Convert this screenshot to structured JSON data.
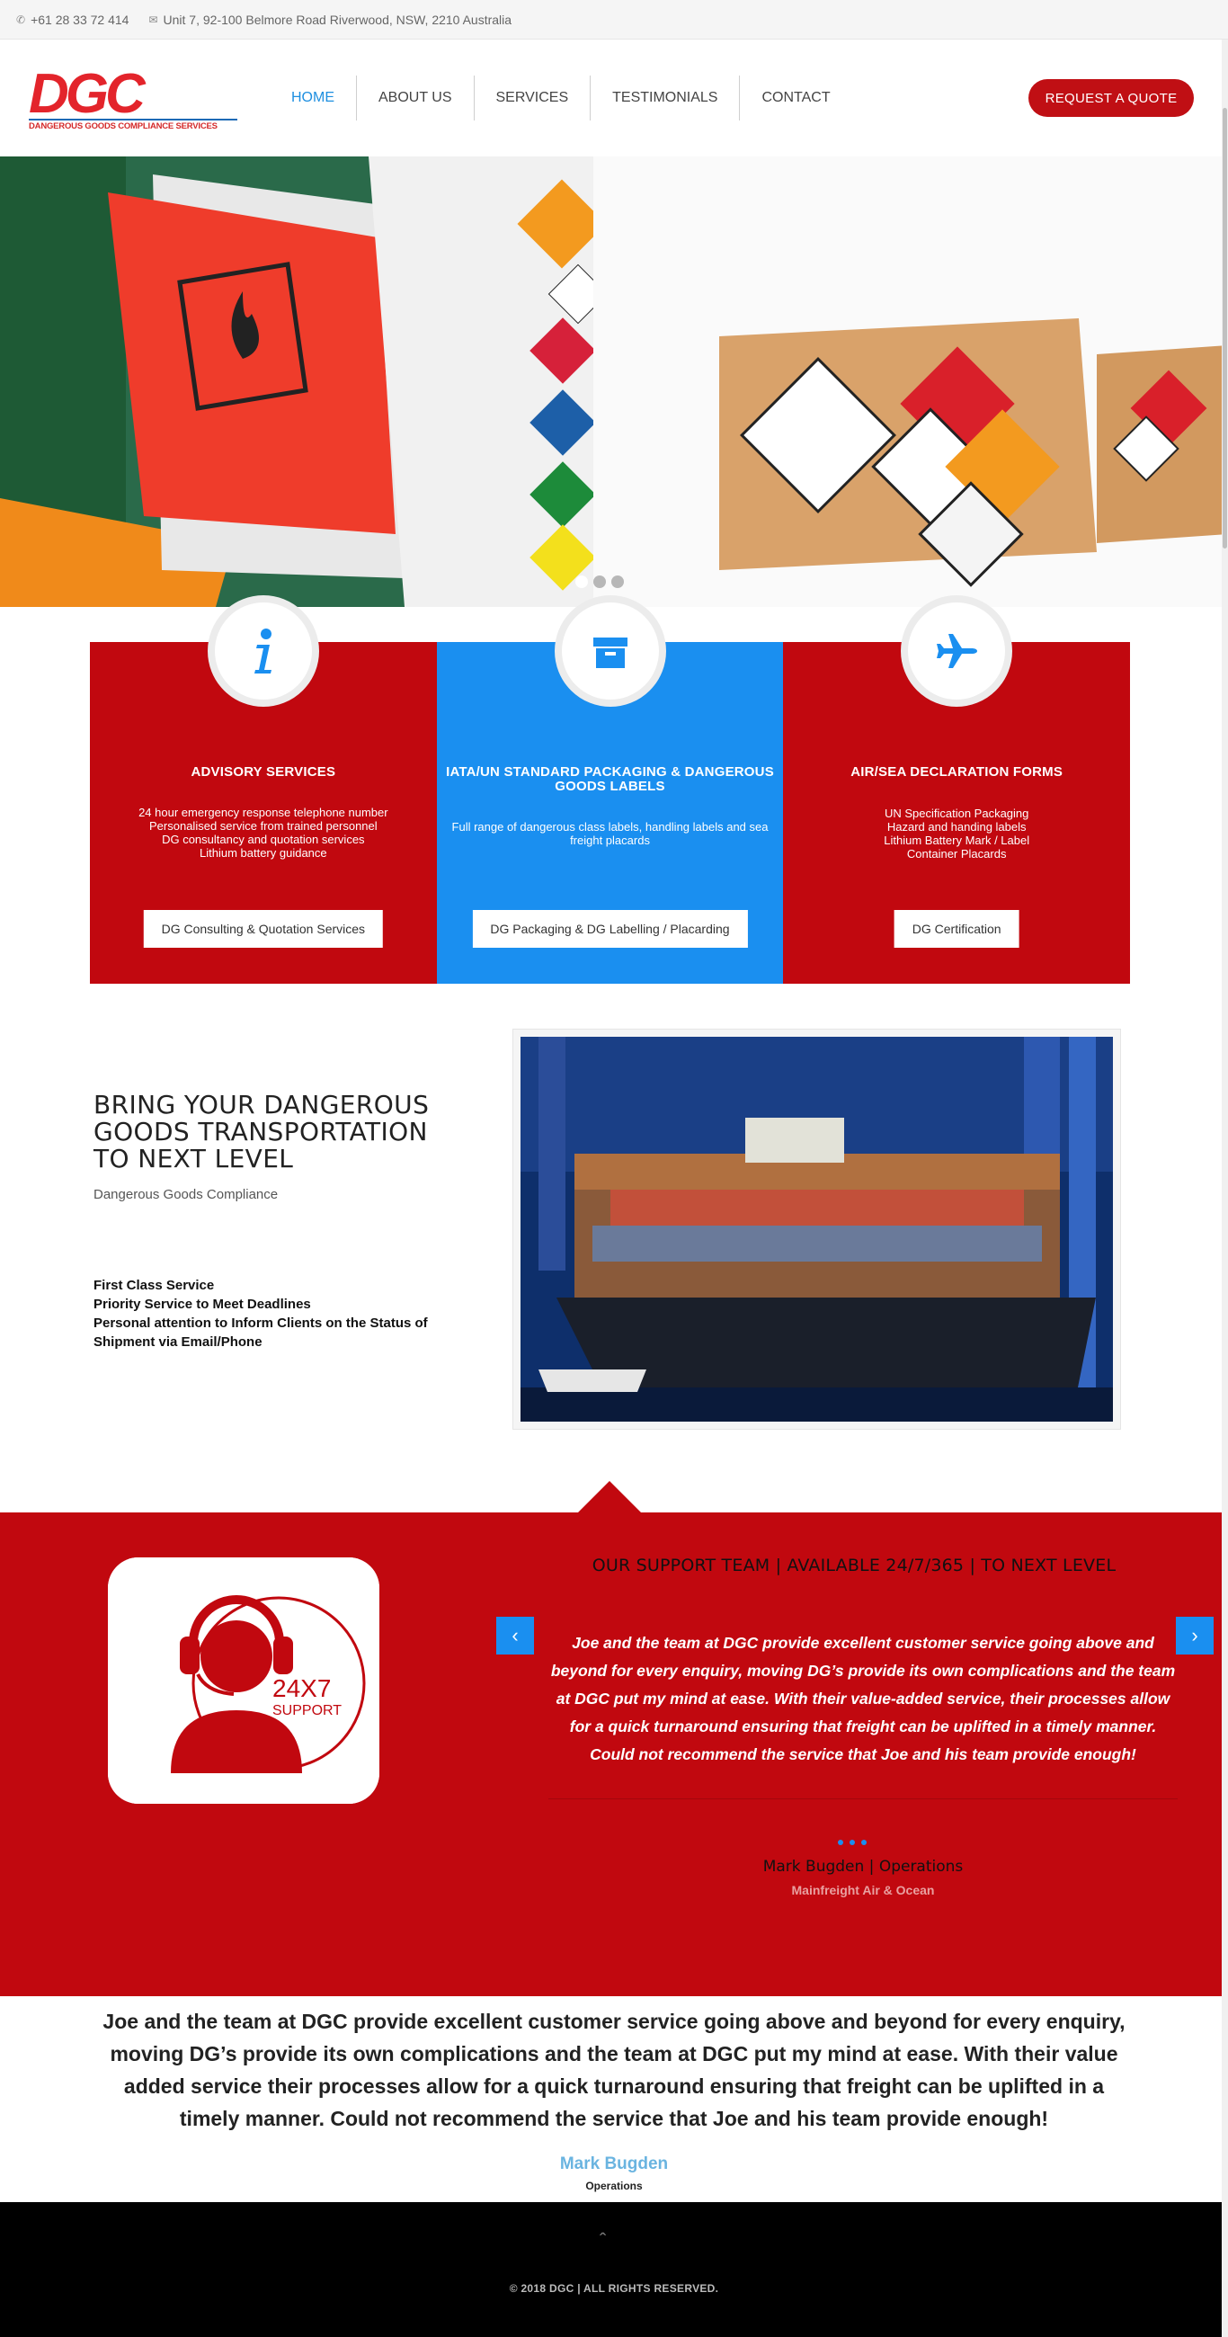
{
  "topbar": {
    "phone": "+61 28 33 72 414",
    "address": "Unit 7, 92-100 Belmore Road Riverwood, NSW, 2210 Australia",
    "phone_icon": "phone-icon",
    "address_icon": "envelope-icon"
  },
  "header": {
    "logo_letters": "DGC",
    "logo_tagline": "DANGEROUS GOODS COMPLIANCE SERVICES",
    "nav": [
      "HOME",
      "ABOUT US",
      "SERVICES",
      "TESTIMONIALS",
      "CONTACT"
    ],
    "active_nav": "HOME",
    "quote_button": "REQUEST A QUOTE"
  },
  "hero": {
    "slide_count": 3,
    "active_slide": 1
  },
  "services": [
    {
      "icon": "info-icon",
      "title": "ADVISORY SERVICES",
      "lines": [
        "24 hour emergency response telephone number",
        "Personalised service from trained personnel",
        "DG consultancy and quotation services",
        "Lithium battery guidance"
      ],
      "button": "DG Consulting & Quotation Services",
      "color": "#c1080f"
    },
    {
      "icon": "archive-box-icon",
      "title": "IATA/UN STANDARD PACKAGING & DANGEROUS GOODS LABELS",
      "lines": [
        "Full range of dangerous class labels, handling labels and sea freight placards"
      ],
      "button": "DG Packaging & DG Labelling / Placarding",
      "color": "#1a8ff0"
    },
    {
      "icon": "airplane-icon",
      "title": "AIR/SEA DECLARATION FORMS",
      "lines": [
        "UN Specification Packaging",
        "Hazard and handing labels",
        "Lithium Battery Mark / Label",
        "Container Placards"
      ],
      "button": "DG Certification",
      "color": "#c1080f"
    }
  ],
  "bring": {
    "heading_lines": [
      "BRING YOUR DANGEROUS",
      "GOODS TRANSPORTATION",
      "TO NEXT LEVEL"
    ],
    "subtitle": "Dangerous Goods Compliance",
    "bullets": [
      "First Class Service",
      "Priority Service to Meet Deadlines",
      "Personal attention to Inform Clients on the Status of Shipment via Email/Phone"
    ]
  },
  "support": {
    "icon_text_1": "24X7",
    "icon_text_2": "SUPPORT",
    "heading": "OUR SUPPORT TEAM | AVAILABLE 24/7/365 | TO NEXT LEVEL",
    "quote": "Joe and the team at DGC provide excellent customer service going above and beyond for every enquiry, moving DG’s provide its own complications and the team at DGC put my mind at ease.  With their value-added service, their processes allow for a quick turnaround ensuring that freight can be uplifted in a timely manner. Could not recommend the service that Joe and his team provide enough!",
    "name": "Mark Bugden | Operations",
    "company": "Mainfreight Air & Ocean",
    "prev_icon": "chevron-left-icon",
    "next_icon": "chevron-right-icon"
  },
  "testimonial": {
    "text": "Joe and the team at DGC provide excellent customer service going above and beyond for every enquiry, moving DG’s provide its own complications and the team at DGC put my mind at ease. With their value added service their processes allow for a quick turnaround ensuring that freight can be uplifted in a timely manner. Could not recommend the service that Joe and his team provide enough!",
    "name": "Mark Bugden",
    "role": "Operations"
  },
  "footer": {
    "to_top_icon": "chevron-up-icon",
    "copyright": "© 2018 DGC | ALL RIGHTS RESERVED."
  },
  "colors": {
    "brand_red": "#c1080f",
    "brand_blue": "#1a8ff0"
  }
}
